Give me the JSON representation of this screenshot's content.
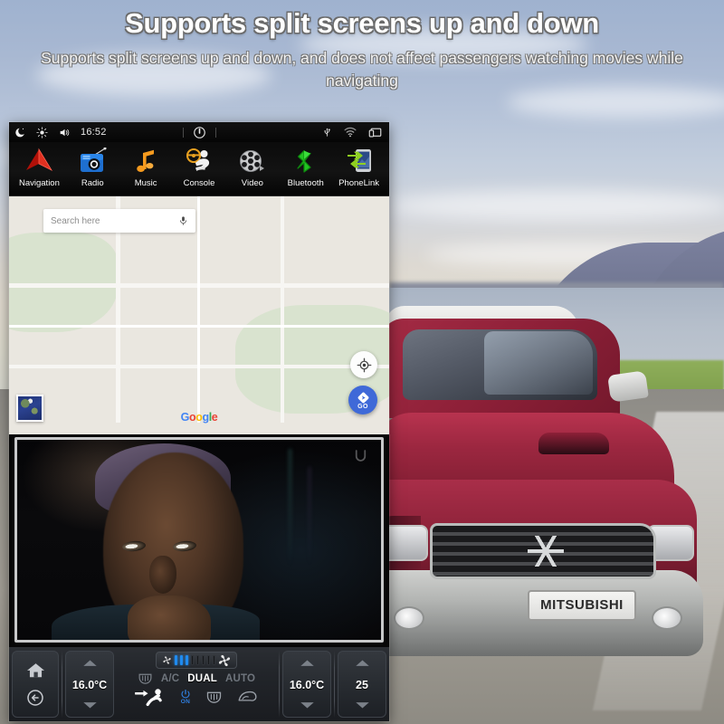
{
  "headline": {
    "title": "Supports split screens up and down",
    "subtitle": "Supports split screens up and down, and does not affect passengers watching movies while navigating"
  },
  "head_unit": {
    "status_bar": {
      "time": "16:52",
      "left_icons": [
        "night-mode-icon",
        "brightness-icon",
        "volume-icon"
      ],
      "center_icons": [
        "power-icon"
      ],
      "right_icons": [
        "usb-icon",
        "wifi-icon",
        "screen-icon"
      ]
    },
    "app_dock": [
      {
        "label": "Navigation",
        "icon": "navigation-arrow-icon"
      },
      {
        "label": "Radio",
        "icon": "radio-icon"
      },
      {
        "label": "Music",
        "icon": "music-note-icon"
      },
      {
        "label": "Console",
        "icon": "console-icon"
      },
      {
        "label": "Video",
        "icon": "film-reel-icon"
      },
      {
        "label": "Bluetooth",
        "icon": "bluetooth-icon"
      },
      {
        "label": "PhoneLink",
        "icon": "phonelink-icon"
      }
    ],
    "map": {
      "search_placeholder": "Search here",
      "search_value": "",
      "mic_icon": "microphone-icon",
      "locate_icon": "my-location-icon",
      "go_label": "GO",
      "go_icon": "navigation-diamond-icon",
      "layer_thumb": "satellite-layer-thumbnail",
      "attribution": "Google",
      "attribution_letters": [
        "G",
        "o",
        "o",
        "g",
        "l",
        "e"
      ]
    },
    "video": {
      "return_icon": "return-arrow-icon"
    },
    "climate": {
      "home_icon": "home-icon",
      "back_icon": "back-arrow-icon",
      "left_temp": "16.0°C",
      "right_temp": "16.0°C",
      "volume_value": "25",
      "fan_ticks_on": 3,
      "fan_ticks_off": 5,
      "fan_low_icon": "fan-low-icon",
      "fan_high_icon": "fan-high-icon",
      "modes": [
        {
          "label": "A/C",
          "active": false
        },
        {
          "label": "DUAL",
          "active": true
        },
        {
          "label": "AUTO",
          "active": false
        }
      ],
      "rear_defrost_icon": "rear-defrost-icon",
      "airflow_icon": "airflow-face-icon",
      "power_label": "ON",
      "power_icon": "power-icon",
      "defrost_rear_icon": "rear-window-defrost-icon",
      "defrost_front_icon": "windshield-defrost-icon",
      "accent_color": "#2f7fe0"
    }
  },
  "background": {
    "vehicle_plate": "MITSUBISHI"
  }
}
